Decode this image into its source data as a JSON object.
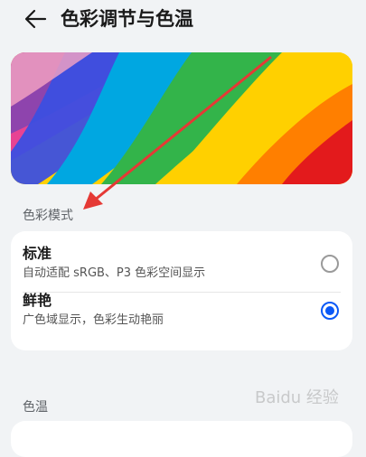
{
  "header": {
    "title": "色彩调节与色温",
    "back_icon": "arrow-left-icon"
  },
  "banner": {
    "description_icon": "rainbow-wallpaper-image",
    "colors": [
      "#e31a1c",
      "#ff7f00",
      "#ffd000",
      "#33b44a",
      "#00a7e1",
      "#3c4fe0",
      "#8e44ad",
      "#e84393"
    ]
  },
  "color_mode": {
    "section_label": "色彩模式",
    "options": [
      {
        "title": "标准",
        "description": "自动适配 sRGB、P3 色彩空间显示",
        "selected": false
      },
      {
        "title": "鲜艳",
        "description": "广色域显示，色彩生动艳丽",
        "selected": true
      }
    ]
  },
  "color_temperature": {
    "section_label": "色温"
  },
  "accent_color": "#0a59f7",
  "annotation": {
    "color": "#e53935",
    "icon": "red-arrow-annotation"
  },
  "watermark": "Baidu 经验"
}
